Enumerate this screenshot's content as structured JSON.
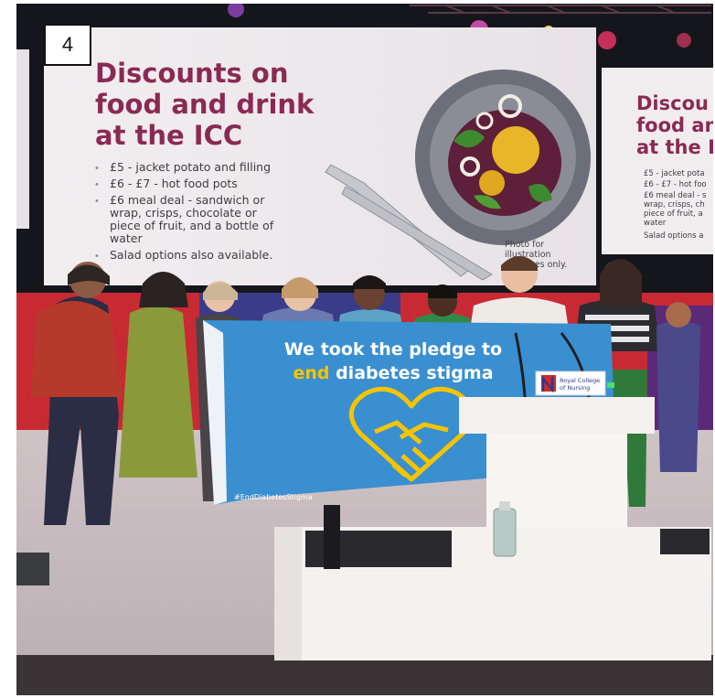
{
  "badge": {
    "number": "4"
  },
  "screen_main": {
    "title_lines": [
      "Discounts on",
      "food and drink",
      "at the ICC"
    ],
    "bullets": [
      "£5 - jacket potato and filling",
      "£6 - £7 - hot food pots",
      "£6 meal deal - sandwich or",
      "wrap, crisps, chocolate or",
      "piece of fruit, and a bottle of",
      "water",
      "Salad options also available."
    ],
    "photo_caption": [
      "Photo for",
      "illustration",
      "purposes only."
    ]
  },
  "screen_right": {
    "title_lines": [
      "Discou",
      "food an",
      "at the I"
    ],
    "bullets": [
      "£5 - jacket pota",
      "£6 - £7 - hot foo",
      "£6 meal deal - s",
      "wrap, crisps, ch",
      "piece of fruit, a",
      "water",
      "Salad options a"
    ]
  },
  "banner": {
    "line1": "We took the pledge to",
    "line2_highlight": "end",
    "line2_rest": " diabetes stigma",
    "hashtag": "#EndDiabetesStigma"
  },
  "lectern": {
    "logo_lines": [
      "Royal College",
      "of Nursing"
    ]
  },
  "colors": {
    "slide_title": "#8a2a52",
    "banner_blue": "#3a8fd0",
    "banner_yellow": "#f5c400",
    "stage_red": "#d8262c"
  }
}
